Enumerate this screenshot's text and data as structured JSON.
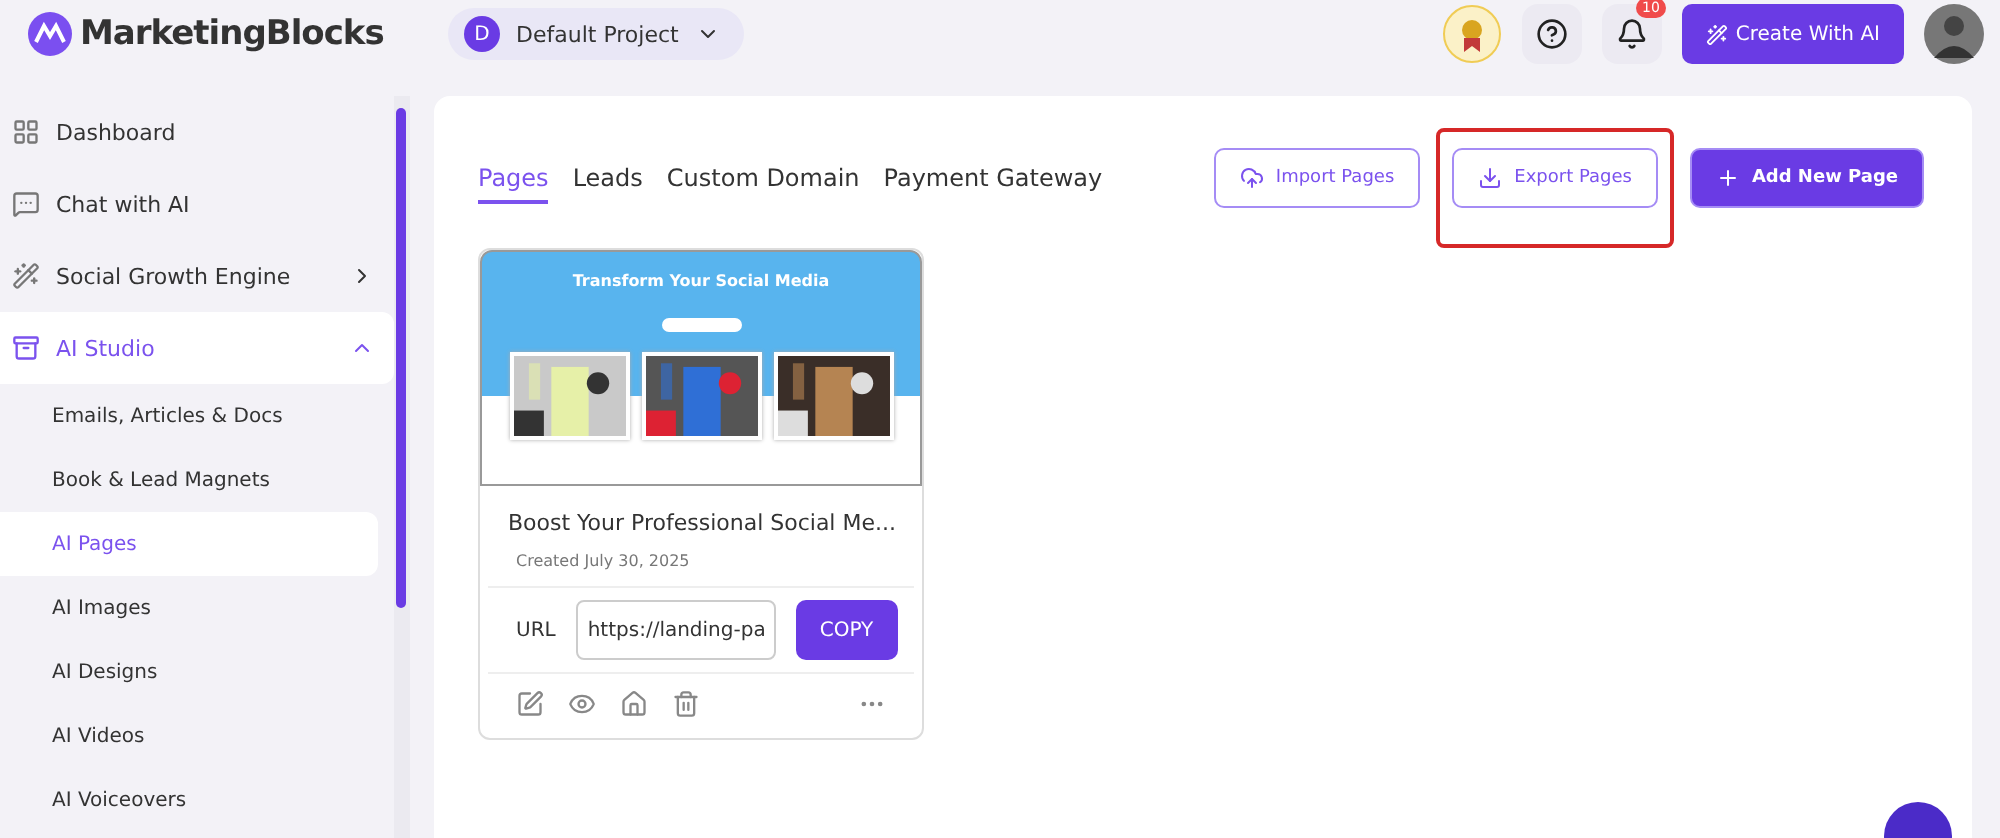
{
  "header": {
    "brand": "MarketingBlocks",
    "project": {
      "initial": "D",
      "name": "Default Project"
    },
    "notifications": "10",
    "create_button": "Create With AI"
  },
  "sidebar": {
    "items": [
      {
        "label": "Dashboard",
        "selected": false
      },
      {
        "label": "Chat with AI",
        "selected": false
      },
      {
        "label": "Social Growth Engine",
        "selected": false,
        "expanded": false
      },
      {
        "label": "AI Studio",
        "selected": true,
        "expanded": true,
        "children": [
          {
            "label": "Emails, Articles & Docs",
            "selected": false
          },
          {
            "label": "Book & Lead Magnets",
            "selected": false
          },
          {
            "label": "AI Pages",
            "selected": true
          },
          {
            "label": "AI Images",
            "selected": false
          },
          {
            "label": "AI Designs",
            "selected": false
          },
          {
            "label": "AI Videos",
            "selected": false
          },
          {
            "label": "AI Voiceovers",
            "selected": false
          }
        ]
      }
    ]
  },
  "tabs": [
    {
      "label": "Pages",
      "selected": true
    },
    {
      "label": "Leads",
      "selected": false
    },
    {
      "label": "Custom Domain",
      "selected": false
    },
    {
      "label": "Payment Gateway",
      "selected": false
    }
  ],
  "actions": [
    {
      "label": "Import Pages",
      "kind": "import",
      "highlighted": false
    },
    {
      "label": "Export Pages",
      "kind": "export",
      "highlighted": true
    },
    {
      "label": "Add New Page",
      "kind": "add",
      "highlighted": false
    }
  ],
  "cards": [
    {
      "preview_title": "Transform Your Social Media",
      "title": "Boost Your Professional Social Me...",
      "created": "Created July 30, 2025",
      "url_label": "URL",
      "url": "https://landing-pa",
      "copy": "COPY"
    }
  ]
}
